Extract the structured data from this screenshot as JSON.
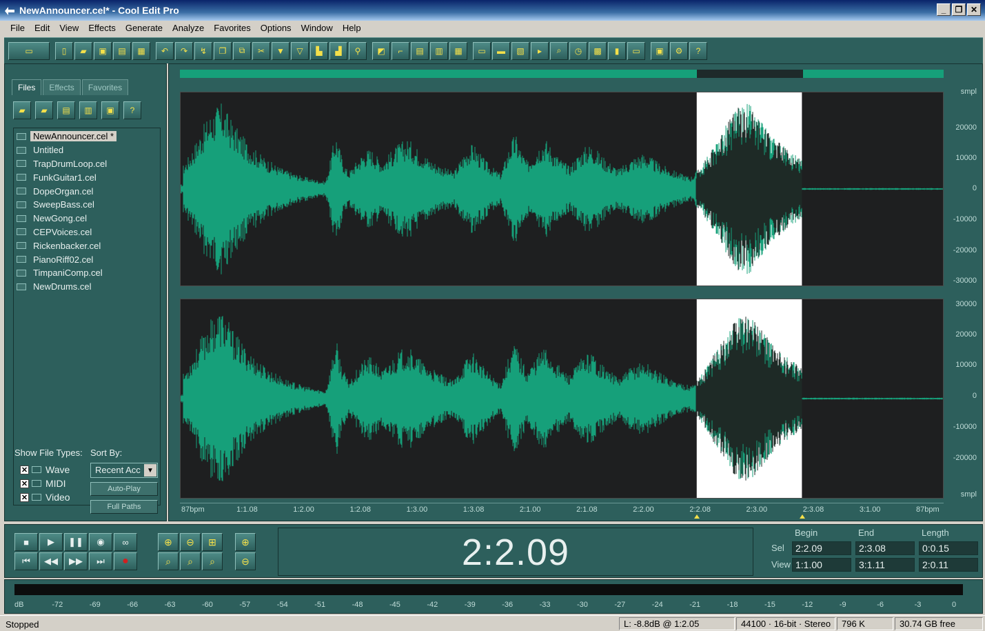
{
  "window": {
    "title": "NewAnnouncer.cel* - Cool Edit Pro"
  },
  "menu": [
    "File",
    "Edit",
    "View",
    "Effects",
    "Generate",
    "Analyze",
    "Favorites",
    "Options",
    "Window",
    "Help"
  ],
  "colors": {
    "panel": "#2d5f5c",
    "waveform": "#16a07a",
    "selection": "#ffffff",
    "wave_bg": "#1e1f20"
  },
  "organizer": {
    "tabs": [
      "Files",
      "Effects",
      "Favorites"
    ],
    "active_tab": "Files",
    "files": [
      "NewAnnouncer.cel *",
      "Untitled",
      "TrapDrumLoop.cel",
      "FunkGuitar1.cel",
      "DopeOrgan.cel",
      "SweepBass.cel",
      "NewGong.cel",
      "CEPVoices.cel",
      "Rickenbacker.cel",
      "PianoRiff02.cel",
      "TimpaniComp.cel",
      "NewDrums.cel"
    ],
    "selected_file": "NewAnnouncer.cel *",
    "show_file_types_label": "Show File Types:",
    "sort_by_label": "Sort By:",
    "types": [
      {
        "label": "Wave",
        "checked": true
      },
      {
        "label": "MIDI",
        "checked": true
      },
      {
        "label": "Video",
        "checked": true
      }
    ],
    "sort_value": "Recent Acc",
    "auto_play_label": "Auto-Play",
    "full_paths_label": "Full Paths"
  },
  "waveform": {
    "amp_unit": "smpl",
    "amp_labels_top": [
      "20000",
      "10000",
      "0",
      "-10000",
      "-20000",
      "-30000"
    ],
    "amp_labels_bottom": [
      "30000",
      "20000",
      "10000",
      "0",
      "-10000",
      "-20000"
    ],
    "time_labels": [
      "87bpm",
      "1:1.08",
      "1:2.00",
      "1:2.08",
      "1:3.00",
      "1:3.08",
      "2:1.00",
      "2:1.08",
      "2:2.00",
      "2:2.08",
      "2:3.00",
      "2:3.08",
      "3:1.00",
      "87bpm"
    ],
    "selection_fraction": [
      0.677,
      0.815
    ],
    "view_fraction": [
      0.677,
      0.815
    ]
  },
  "transport": {
    "buttons_row1": [
      "stop",
      "play",
      "pause",
      "play-from-cursor",
      "loop"
    ],
    "buttons_row2": [
      "go-to-start",
      "rewind",
      "fast-forward",
      "go-to-end",
      "record"
    ],
    "time_display": "2:2.09"
  },
  "selection": {
    "headers": [
      "Begin",
      "End",
      "Length"
    ],
    "sel_label": "Sel",
    "view_label": "View",
    "sel": [
      "2:2.09",
      "2:3.08",
      "0:0.15"
    ],
    "view": [
      "1:1.00",
      "3:1.11",
      "2:0.11"
    ]
  },
  "level_meter": {
    "ticks": [
      "dB",
      "-72",
      "-69",
      "-66",
      "-63",
      "-60",
      "-57",
      "-54",
      "-51",
      "-48",
      "-45",
      "-42",
      "-39",
      "-36",
      "-33",
      "-30",
      "-27",
      "-24",
      "-21",
      "-18",
      "-15",
      "-12",
      "-9",
      "-6",
      "-3",
      "0"
    ]
  },
  "status": {
    "state": "Stopped",
    "level": "L: -8.8dB @ 1:2.05",
    "format": "44100 · 16-bit · Stereo",
    "size": "796 K",
    "free": "30.74 GB free"
  }
}
